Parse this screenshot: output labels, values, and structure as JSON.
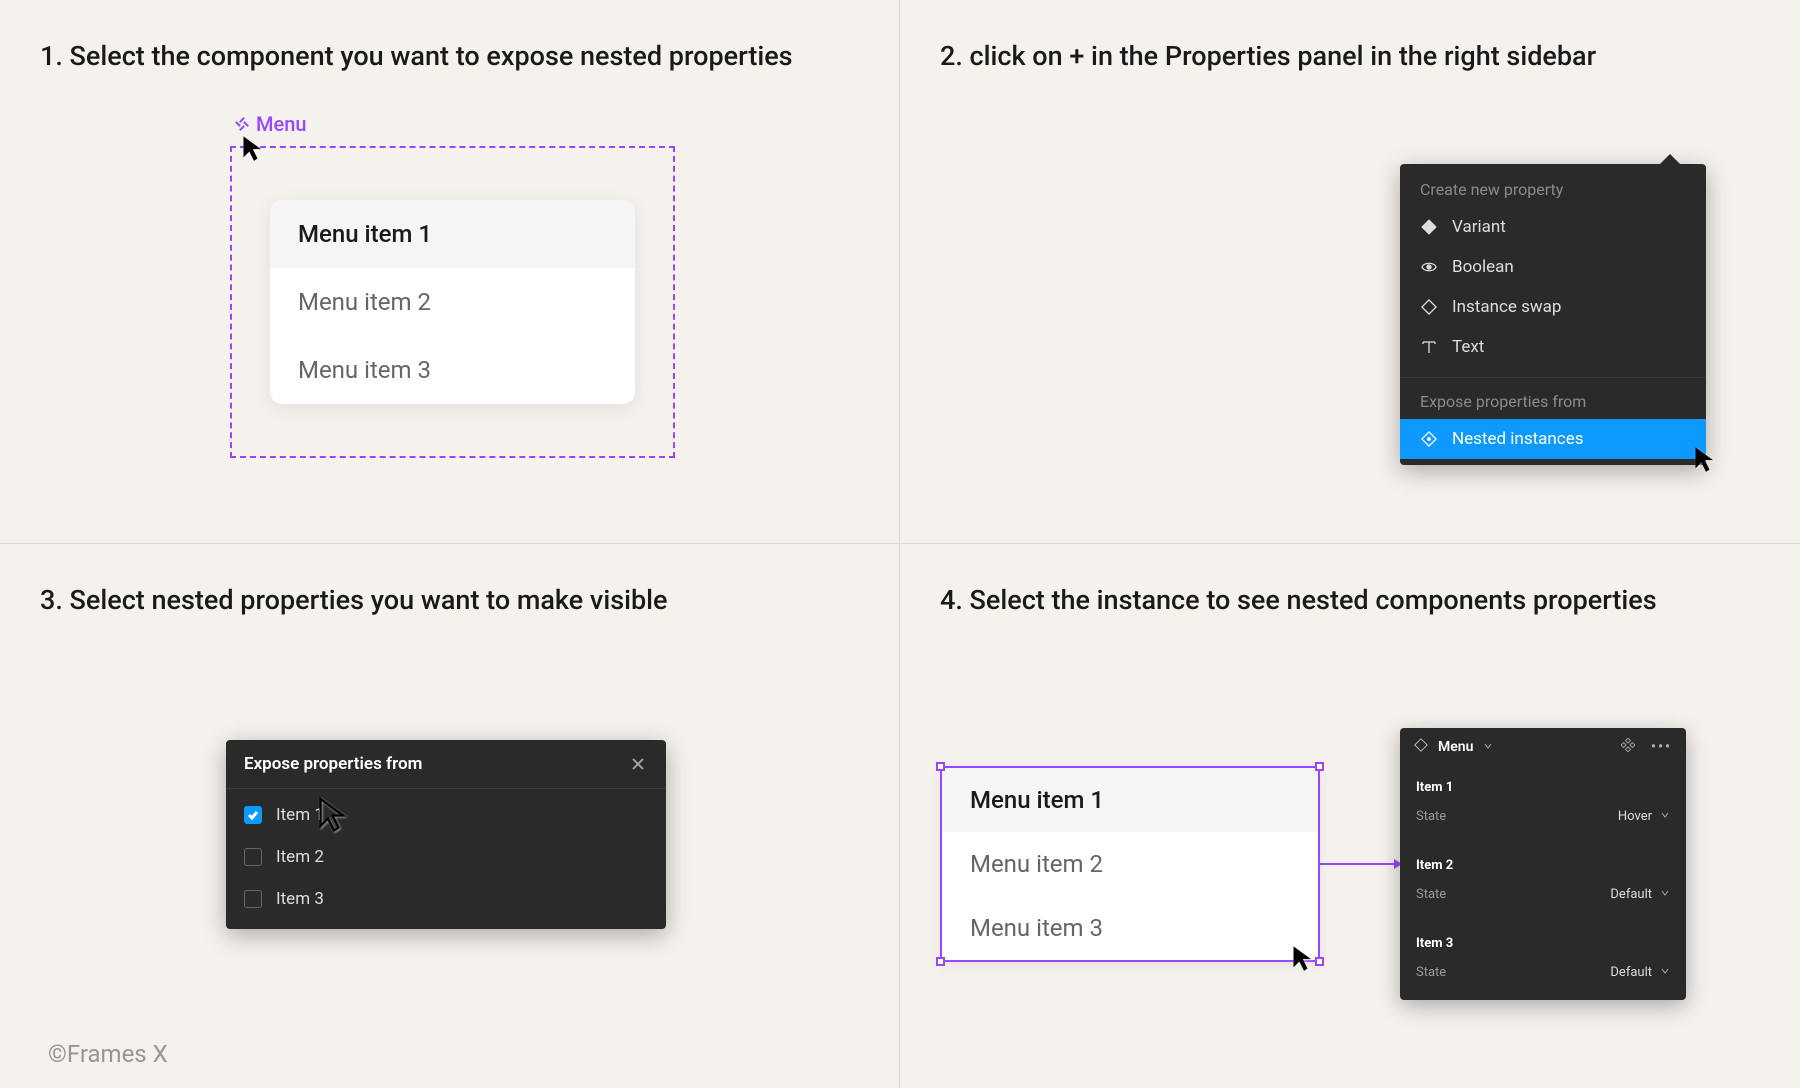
{
  "steps": {
    "s1": {
      "title": "1. Select the component you want to expose nested properties"
    },
    "s2": {
      "title": "2. click on + in the Properties panel in the right sidebar"
    },
    "s3": {
      "title": "3. Select nested properties you want to make visible"
    },
    "s4": {
      "title": "4. Select the instance to see nested components properties"
    }
  },
  "component_label": "Menu",
  "menu_items": [
    "Menu item 1",
    "Menu item 2",
    "Menu item 3"
  ],
  "ctx": {
    "header": "Create new property",
    "items": [
      {
        "icon": "diamond-solid-icon",
        "label": "Variant"
      },
      {
        "icon": "eye-icon",
        "label": "Boolean"
      },
      {
        "icon": "diamond-outline-icon",
        "label": "Instance swap"
      },
      {
        "icon": "text-icon",
        "label": "Text"
      }
    ],
    "subheader": "Expose properties from",
    "highlight": {
      "icon": "nested-icon",
      "label": "Nested instances"
    }
  },
  "expose": {
    "title": "Expose properties from",
    "items": [
      {
        "label": "Item 1",
        "checked": true
      },
      {
        "label": "Item 2",
        "checked": false
      },
      {
        "label": "Item 3",
        "checked": false
      }
    ]
  },
  "props_panel": {
    "title": "Menu",
    "sections": [
      {
        "name": "Item 1",
        "rows": [
          {
            "label": "State",
            "value": "Hover"
          }
        ]
      },
      {
        "name": "Item 2",
        "rows": [
          {
            "label": "State",
            "value": "Default"
          }
        ]
      },
      {
        "name": "Item 3",
        "rows": [
          {
            "label": "State",
            "value": "Default"
          }
        ]
      }
    ]
  },
  "footer": "©Frames X",
  "colors": {
    "purple": "#9747ff",
    "blue": "#0d99ff",
    "panel": "#2a2a2a"
  }
}
